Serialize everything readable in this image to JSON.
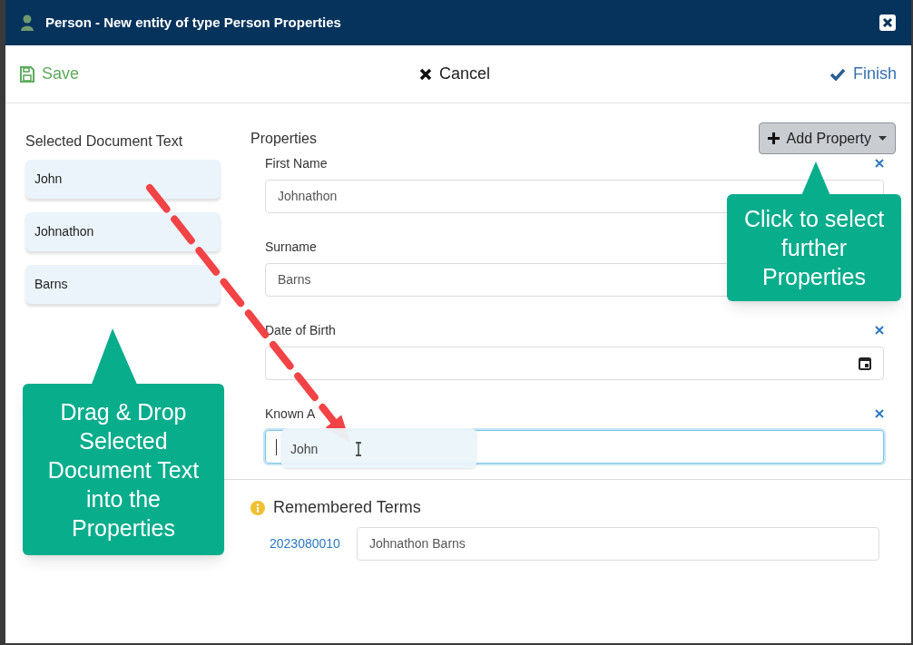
{
  "window": {
    "title": "Person - New entity of type Person Properties"
  },
  "toolbar": {
    "save": "Save",
    "cancel": "Cancel",
    "finish": "Finish"
  },
  "selected_text": {
    "heading": "Selected Document Text",
    "items": [
      "John",
      "Johnathon",
      "Barns"
    ]
  },
  "properties": {
    "heading": "Properties",
    "add_button": "Add Property",
    "fields": [
      {
        "label": "First Name",
        "value": "Johnathon",
        "kind": "text",
        "removable": true,
        "focused": false
      },
      {
        "label": "Surname",
        "value": "Barns",
        "kind": "text",
        "focused": false
      },
      {
        "label": "Date of Birth",
        "kind": "date",
        "removable": true,
        "focused": false
      },
      {
        "label": "Known A",
        "kind": "text",
        "removable": true,
        "focused": true
      }
    ]
  },
  "drag_ghost": "John",
  "remembered_terms": {
    "heading": "Remembered Terms",
    "rows": [
      {
        "id": "2023080010",
        "value": "Johnathon Barns"
      }
    ]
  },
  "callouts": [
    {
      "text": "Click to select further Properties"
    },
    {
      "text": "Drag & Drop Selected Document Text into the Properties"
    }
  ]
}
